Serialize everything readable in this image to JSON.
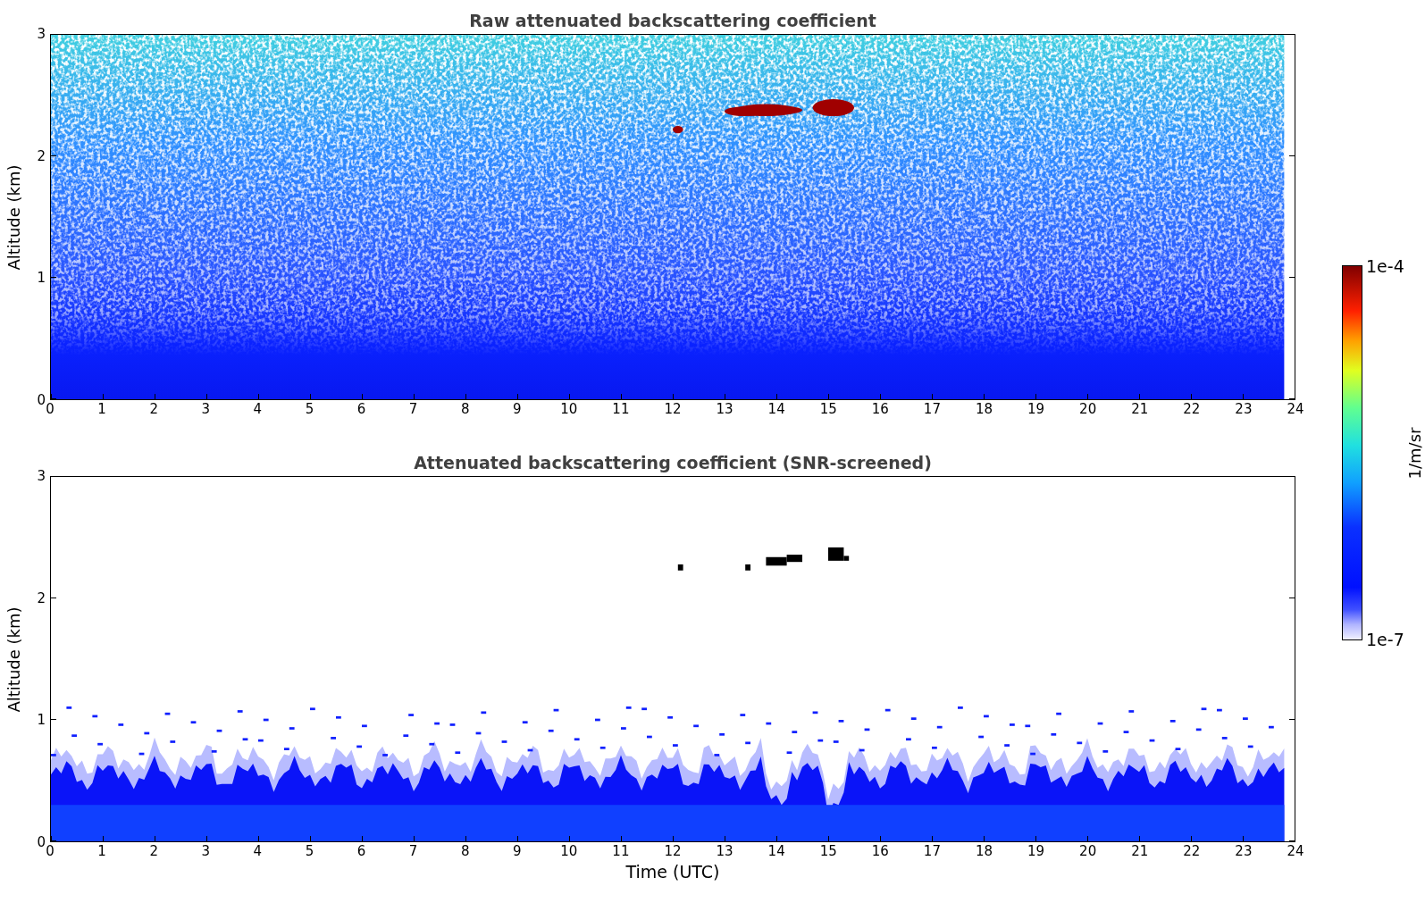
{
  "figure": {
    "panels": [
      {
        "kind": "raw",
        "title": "Raw attenuated backscattering coefficient",
        "ylabel": "Altitude (km)",
        "yticks": [
          "3",
          "2",
          "1",
          "0"
        ],
        "xticks": [
          "0",
          "1",
          "2",
          "3",
          "4",
          "5",
          "6",
          "7",
          "8",
          "9",
          "10",
          "11",
          "12",
          "13",
          "14",
          "15",
          "16",
          "17",
          "18",
          "19",
          "20",
          "21",
          "22",
          "23",
          "24"
        ]
      },
      {
        "kind": "screened",
        "title": "Attenuated backscattering coefficient (SNR-screened)",
        "ylabel": "Altitude (km)",
        "yticks": [
          "3",
          "2",
          "1",
          "0"
        ],
        "xticks": [
          "0",
          "1",
          "2",
          "3",
          "4",
          "5",
          "6",
          "7",
          "8",
          "9",
          "10",
          "11",
          "12",
          "13",
          "14",
          "15",
          "16",
          "17",
          "18",
          "19",
          "20",
          "21",
          "22",
          "23",
          "24"
        ],
        "xlabel": "Time (UTC)"
      }
    ],
    "colorbar": {
      "max_label": "1e-4",
      "min_label": "1e-7",
      "label": "1/m/sr"
    }
  }
}
